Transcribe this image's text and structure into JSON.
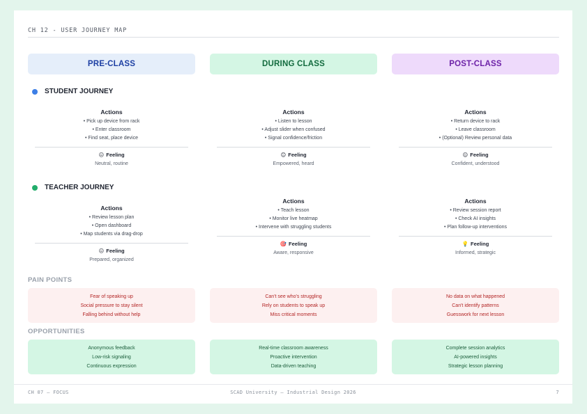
{
  "header": {
    "chapter": "CH 12 - USER JOURNEY MAP"
  },
  "columns": [
    {
      "label": "PRE-CLASS"
    },
    {
      "label": "DURING CLASS"
    },
    {
      "label": "POST-CLASS"
    }
  ],
  "colors": {
    "student_dot": "#3d7fe6",
    "teacher_dot": "#22ad6b"
  },
  "student": {
    "label": "STUDENT JOURNEY",
    "cells": [
      {
        "actions_title": "Actions",
        "actions": [
          "• Pick up device from rack",
          "• Enter classroom",
          "• Find seat, place device"
        ],
        "feeling_icon": "😐",
        "feeling_title": "Feeling",
        "feeling_desc": "Neutral, routine"
      },
      {
        "actions_title": "Actions",
        "actions": [
          "• Listen to lesson",
          "• Adjust slider when confused",
          "• Signal confidence/friction"
        ],
        "feeling_icon": "😊",
        "feeling_title": "Feeling",
        "feeling_desc": "Empowered, heard"
      },
      {
        "actions_title": "Actions",
        "actions": [
          "• Return device to rack",
          "• Leave classroom",
          "• (Optional) Review personal data"
        ],
        "feeling_icon": "😌",
        "feeling_title": "Feeling",
        "feeling_desc": "Confident, understood"
      }
    ]
  },
  "teacher": {
    "label": "TEACHER JOURNEY",
    "cells": [
      {
        "actions_title": "Actions",
        "actions": [
          "• Review lesson plan",
          "• Open dashboard",
          "• Map students via drag-drop"
        ],
        "feeling_icon": "😐",
        "feeling_title": "Feeling",
        "feeling_desc": "Prepared, organized"
      },
      {
        "actions_title": "Actions",
        "actions": [
          "• Teach lesson",
          "• Monitor live heatmap",
          "• Intervene with struggling students"
        ],
        "feeling_icon": "🎯",
        "feeling_title": "Feeling",
        "feeling_desc": "Aware, responsive"
      },
      {
        "actions_title": "Actions",
        "actions": [
          "• Review session report",
          "• Check AI insights",
          "• Plan follow-up interventions"
        ],
        "feeling_icon": "💡",
        "feeling_title": "Feeling",
        "feeling_desc": "Informed, strategic"
      }
    ]
  },
  "pain_points": {
    "label": "PAIN POINTS",
    "boxes": [
      [
        "Fear of speaking up",
        "Social pressure to stay silent",
        "Falling behind without help"
      ],
      [
        "Can't see who's struggling",
        "Rely on students to speak up",
        "Miss critical moments"
      ],
      [
        "No data on what happened",
        "Can't identify patterns",
        "Guesswork for next lesson"
      ]
    ]
  },
  "opportunities": {
    "label": "OPPORTUNITIES",
    "boxes": [
      [
        "Anonymous feedback",
        "Low-risk signaling",
        "Continuous expression"
      ],
      [
        "Real-time classroom awareness",
        "Proactive intervention",
        "Data-driven teaching"
      ],
      [
        "Complete session analytics",
        "AI-powered insights",
        "Strategic lesson planning"
      ]
    ]
  },
  "footer": {
    "left": "CH 07 — FOCUS",
    "center": "SCAD University — Industrial Design 2026",
    "right": "7"
  }
}
